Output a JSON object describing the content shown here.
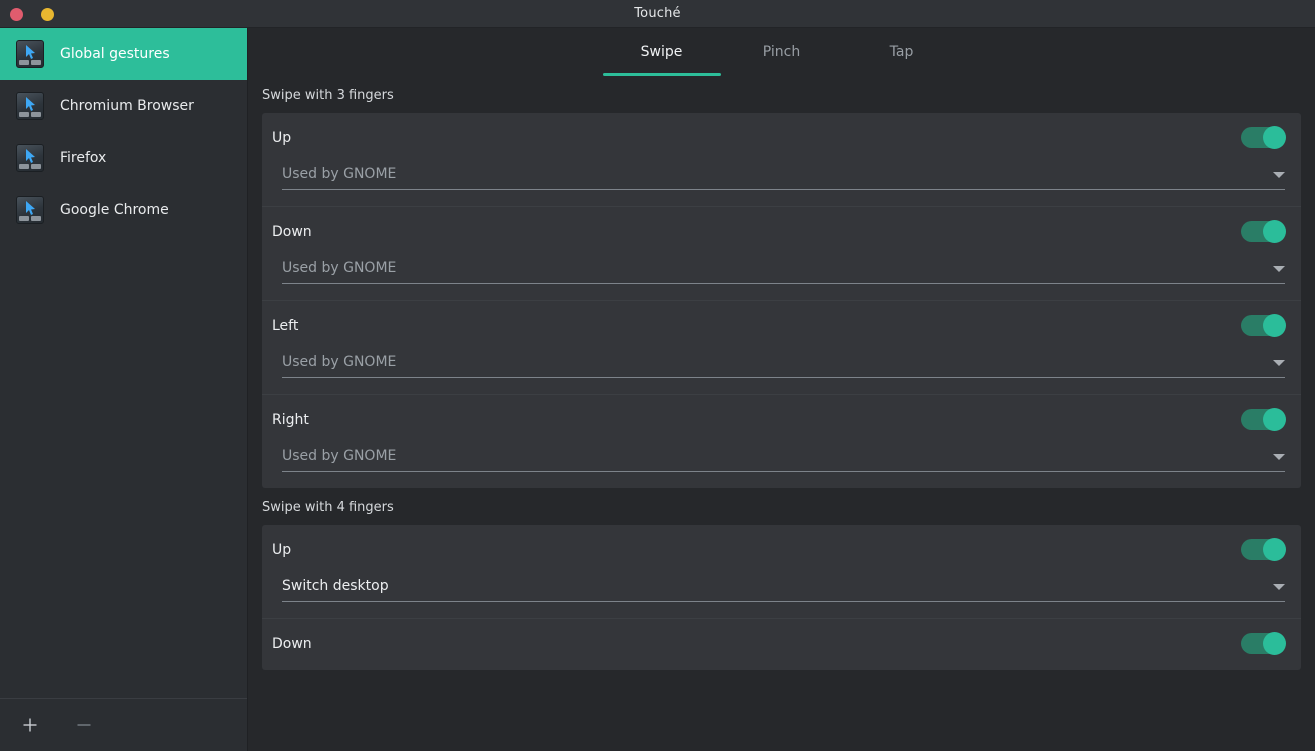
{
  "window": {
    "title": "Touché",
    "controls": [
      {
        "name": "close",
        "color": "#e05c6e"
      },
      {
        "name": "minimize",
        "color": "#e8b730"
      }
    ]
  },
  "theme": {
    "accent": "#2dbe9a",
    "toggle_track": "#2a7d66",
    "toggle_knob": "#2bbd9a",
    "background": "#26282b",
    "card": "#34363a",
    "sidebar": "#2b2e32",
    "titlebar": "#303337"
  },
  "sidebar": {
    "items": [
      {
        "label": "Global gestures",
        "icon": "touchpad-icon",
        "selected": true
      },
      {
        "label": "Chromium Browser",
        "icon": "touchpad-icon",
        "selected": false
      },
      {
        "label": "Firefox",
        "icon": "touchpad-icon",
        "selected": false
      },
      {
        "label": "Google Chrome",
        "icon": "touchpad-icon",
        "selected": false
      }
    ],
    "toolbar": {
      "add_label": "+",
      "add_name": "add-application-button",
      "remove_label": "−",
      "remove_name": "remove-application-button"
    }
  },
  "tabs": [
    {
      "label": "Swipe",
      "active": true
    },
    {
      "label": "Pinch",
      "active": false
    },
    {
      "label": "Tap",
      "active": false
    }
  ],
  "sections": [
    {
      "title": "Swipe with 3 fingers",
      "rows": [
        {
          "title": "Up",
          "enabled": true,
          "action": "Used by GNOME",
          "action_filled": false
        },
        {
          "title": "Down",
          "enabled": true,
          "action": "Used by GNOME",
          "action_filled": false
        },
        {
          "title": "Left",
          "enabled": true,
          "action": "Used by GNOME",
          "action_filled": false
        },
        {
          "title": "Right",
          "enabled": true,
          "action": "Used by GNOME",
          "action_filled": false
        }
      ]
    },
    {
      "title": "Swipe with 4 fingers",
      "rows": [
        {
          "title": "Up",
          "enabled": true,
          "action": "Switch desktop",
          "action_filled": true
        },
        {
          "title": "Down",
          "enabled": true,
          "action": "",
          "action_filled": false
        }
      ]
    }
  ]
}
